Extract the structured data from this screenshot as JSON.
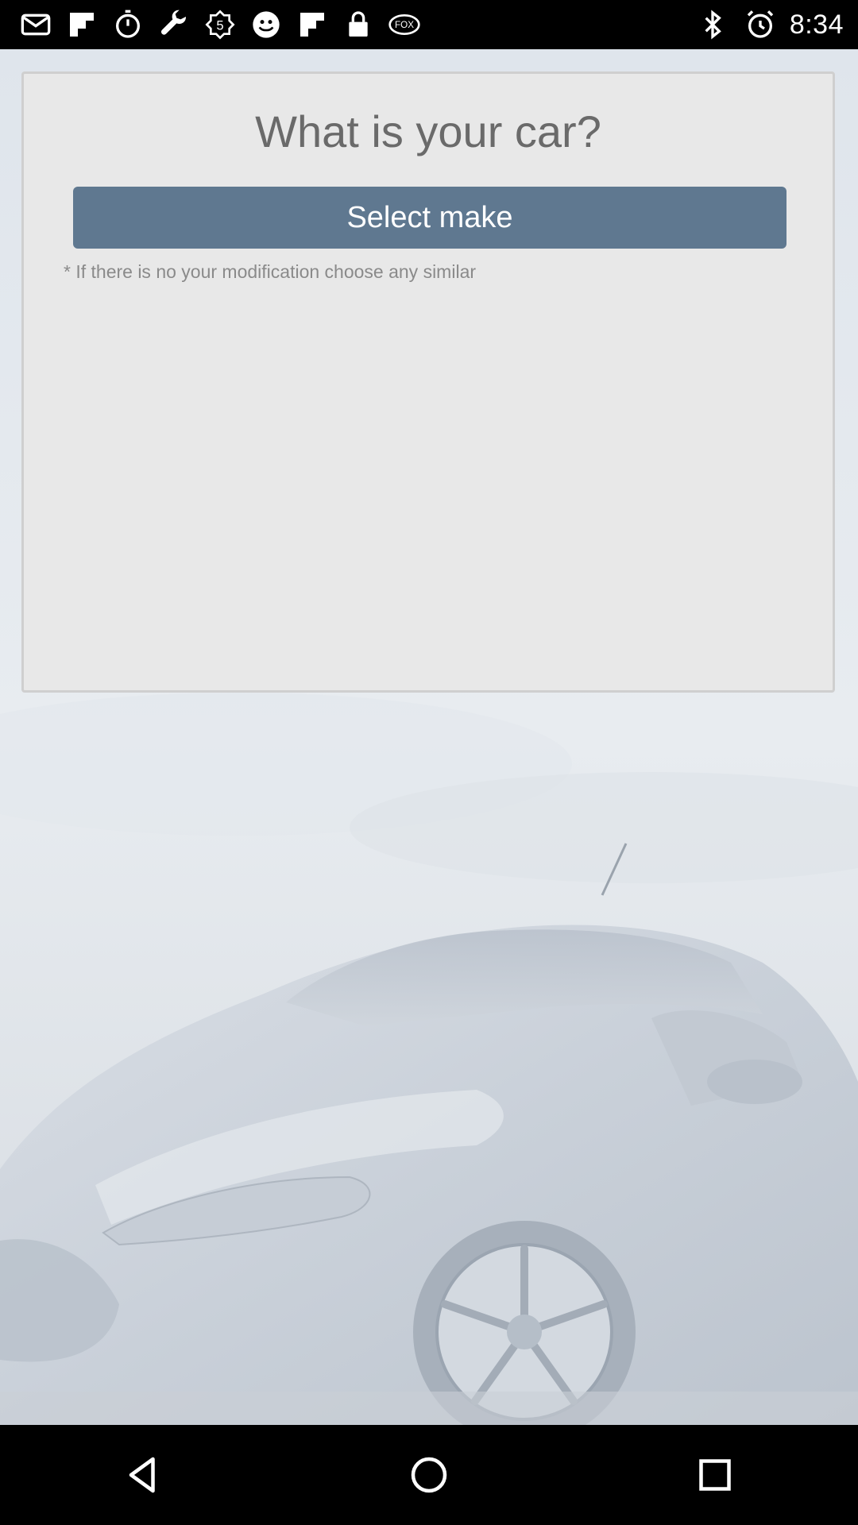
{
  "status_bar": {
    "time": "8:34",
    "left_icons": [
      "mail-icon",
      "flipboard-icon",
      "stopwatch-icon",
      "wrench-icon",
      "fifth-icon",
      "smiley-icon",
      "flipboard-icon",
      "lock-icon",
      "fox-sports-icon"
    ],
    "right_icons": [
      "bluetooth-icon",
      "alarm-icon"
    ]
  },
  "card": {
    "title": "What is your car?",
    "select_make_label": "Select make",
    "hint": "* If there is no your modification choose any similar"
  },
  "colors": {
    "button": "#5f7890",
    "card_bg": "#e8e8e8",
    "title_text": "#6a6a6a"
  },
  "nav_bar": {
    "buttons": [
      "back-icon",
      "home-icon",
      "recents-icon"
    ]
  }
}
